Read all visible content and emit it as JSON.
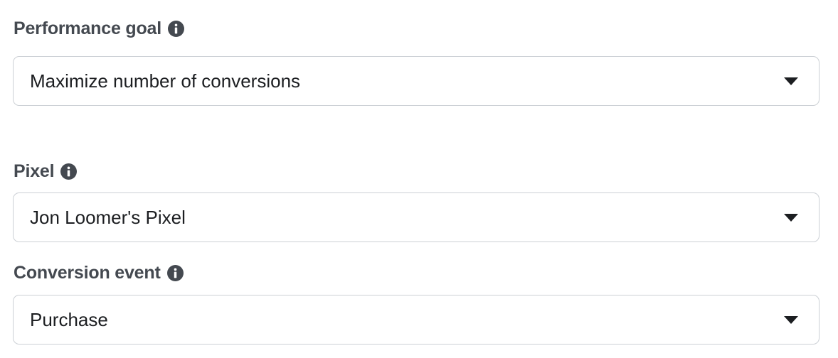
{
  "performance_goal": {
    "label": "Performance goal",
    "value": "Maximize number of conversions"
  },
  "pixel": {
    "label": "Pixel",
    "value": "Jon Loomer's Pixel"
  },
  "conversion_event": {
    "label": "Conversion event",
    "value": "Purchase"
  },
  "icons": {
    "info": "info-icon",
    "dropdown": "caret-down-icon"
  },
  "colors": {
    "label_text": "#444950",
    "value_text": "#1c1e21",
    "border": "#ccd0d5"
  }
}
